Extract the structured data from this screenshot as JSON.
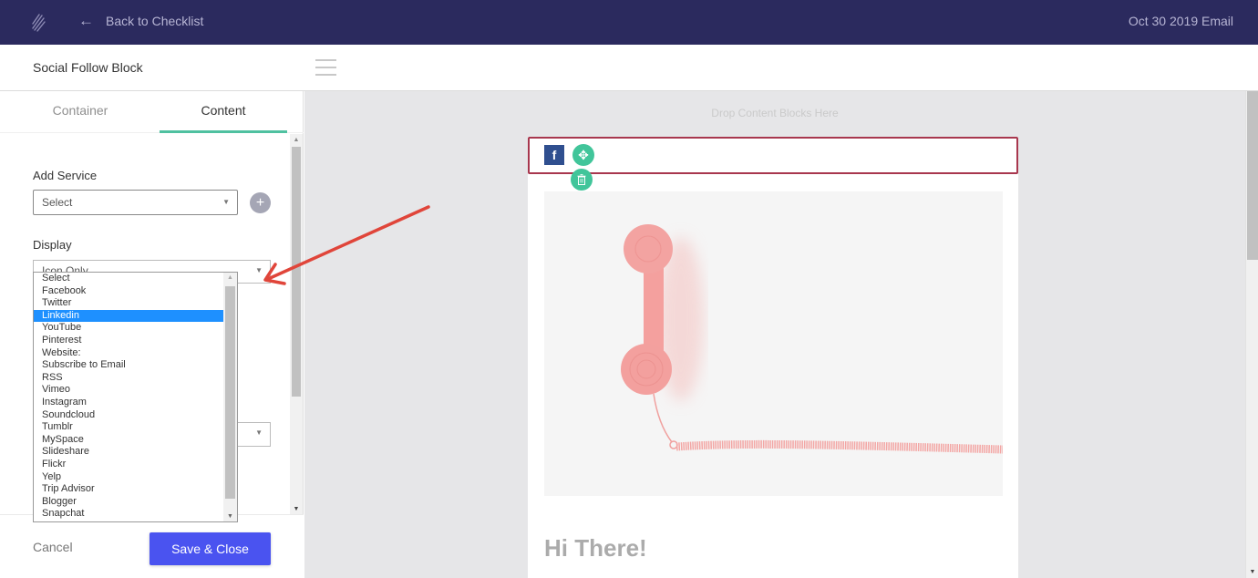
{
  "topbar": {
    "back_label": "Back to Checklist",
    "back_icon": "arrow-left-icon",
    "logo_icon": "brand-slash-logo",
    "email_title": "Oct 30 2019 Email"
  },
  "subbar": {
    "block_title": "Social Follow Block",
    "menu_icon": "hamburger-icon"
  },
  "sidebar": {
    "tabs": [
      {
        "label": "Container",
        "active": false
      },
      {
        "label": "Content",
        "active": true
      }
    ],
    "add_service": {
      "label": "Add Service",
      "value": "Select",
      "add_icon": "plus-icon"
    },
    "display": {
      "label": "Display",
      "value": "Icon Only"
    },
    "service_dropdown": {
      "options": [
        "Select",
        "Facebook",
        "Twitter",
        "Linkedin",
        "YouTube",
        "Pinterest",
        "Website:",
        "Subscribe to Email",
        "RSS",
        "Vimeo",
        "Instagram",
        "Soundcloud",
        "Tumblr",
        "MySpace",
        "Slideshare",
        "Flickr",
        "Yelp",
        "Trip Advisor",
        "Blogger",
        "Snapchat"
      ],
      "highlighted": "Linkedin"
    },
    "footer": {
      "cancel_label": "Cancel",
      "save_label": "Save & Close"
    }
  },
  "canvas": {
    "drop_hint": "Drop Content Blocks Here",
    "social_icons": [
      {
        "name": "facebook",
        "glyph": "f"
      }
    ],
    "move_icon": "move-arrows-icon",
    "delete_icon": "trash-icon",
    "image_subject": "pink telephone handset with coiled cord",
    "heading": "Hi There!"
  },
  "colors": {
    "topbar_bg": "#2b2a5e",
    "accent_green": "#41c59a",
    "tab_underline": "#4fc1a0",
    "save_button": "#4a53f0",
    "selected_block_border": "#a8374e",
    "dropdown_highlight": "#1e90ff",
    "facebook": "#2f4f8f",
    "annotation_arrow": "#e0453a"
  }
}
